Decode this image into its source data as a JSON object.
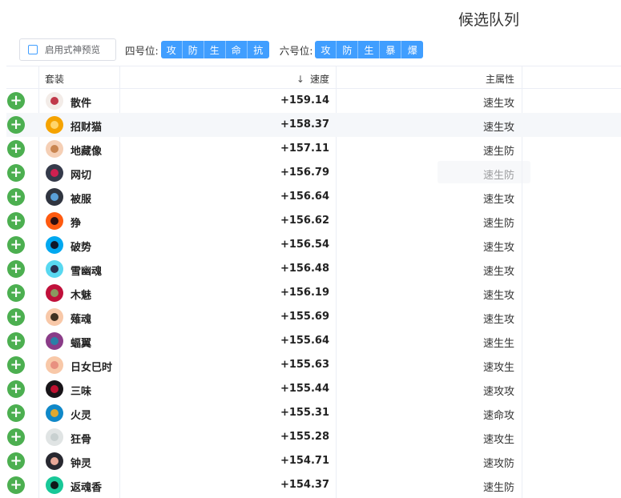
{
  "title": "候选队列",
  "preview_checkbox": {
    "label": "启用式神预览",
    "checked": false
  },
  "slot4": {
    "label": "四号位:",
    "options": [
      "攻",
      "防",
      "生",
      "命",
      "抗"
    ]
  },
  "slot6": {
    "label": "六号位:",
    "options": [
      "攻",
      "防",
      "生",
      "暴",
      "爆"
    ]
  },
  "columns": {
    "set": "套装",
    "speed": "速度",
    "main_attr": "主属性"
  },
  "sort": {
    "column": "speed",
    "direction": "descending",
    "icon": "arrow-down-icon"
  },
  "colors": {
    "accent": "#409eff",
    "add_button": "#4caf50"
  },
  "add_icon": "+",
  "rows": [
    {
      "name": "散件",
      "speed": "+159.14",
      "attr": "速生攻",
      "icon_bg": "#f3ece8",
      "icon_fg": "#c0394a"
    },
    {
      "name": "招财猫",
      "speed": "+158.37",
      "attr": "速生攻",
      "icon_bg": "#f5a300",
      "icon_fg": "#ffd56b"
    },
    {
      "name": "地藏像",
      "speed": "+157.11",
      "attr": "速生防",
      "icon_bg": "#f5cfb5",
      "icon_fg": "#c98550"
    },
    {
      "name": "网切",
      "speed": "+156.79",
      "attr": "速生防",
      "icon_bg": "#353a4a",
      "icon_fg": "#d02050"
    },
    {
      "name": "被服",
      "speed": "+156.64",
      "attr": "速生攻",
      "icon_bg": "#303540",
      "icon_fg": "#5aa0d8"
    },
    {
      "name": "狰",
      "speed": "+156.62",
      "attr": "速生防",
      "icon_bg": "#ff5a10",
      "icon_fg": "#301010"
    },
    {
      "name": "破势",
      "speed": "+156.54",
      "attr": "速生攻",
      "icon_bg": "#00a8f0",
      "icon_fg": "#101828"
    },
    {
      "name": "雪幽魂",
      "speed": "+156.48",
      "attr": "速生攻",
      "icon_bg": "#58d8f0",
      "icon_fg": "#283050"
    },
    {
      "name": "木魅",
      "speed": "+156.19",
      "attr": "速生攻",
      "icon_bg": "#c0103a",
      "icon_fg": "#8a9860"
    },
    {
      "name": "薙魂",
      "speed": "+155.69",
      "attr": "速生攻",
      "icon_bg": "#f8c8a8",
      "icon_fg": "#403020"
    },
    {
      "name": "蝠翼",
      "speed": "+155.64",
      "attr": "速生生",
      "icon_bg": "#8a3c88",
      "icon_fg": "#2a80a8"
    },
    {
      "name": "日女巳时",
      "speed": "+155.63",
      "attr": "速攻生",
      "icon_bg": "#f8c8a8",
      "icon_fg": "#e89080"
    },
    {
      "name": "三味",
      "speed": "+155.44",
      "attr": "速攻攻",
      "icon_bg": "#181418",
      "icon_fg": "#c01030"
    },
    {
      "name": "火灵",
      "speed": "+155.31",
      "attr": "速命攻",
      "icon_bg": "#1088c8",
      "icon_fg": "#e0a830"
    },
    {
      "name": "狂骨",
      "speed": "+155.28",
      "attr": "速攻生",
      "icon_bg": "#e0e4e4",
      "icon_fg": "#c8d0d0"
    },
    {
      "name": "钟灵",
      "speed": "+154.71",
      "attr": "速攻防",
      "icon_bg": "#282830",
      "icon_fg": "#e8a898"
    },
    {
      "name": "返魂香",
      "speed": "+154.37",
      "attr": "速生防",
      "icon_bg": "#18c898",
      "icon_fg": "#101818"
    }
  ]
}
